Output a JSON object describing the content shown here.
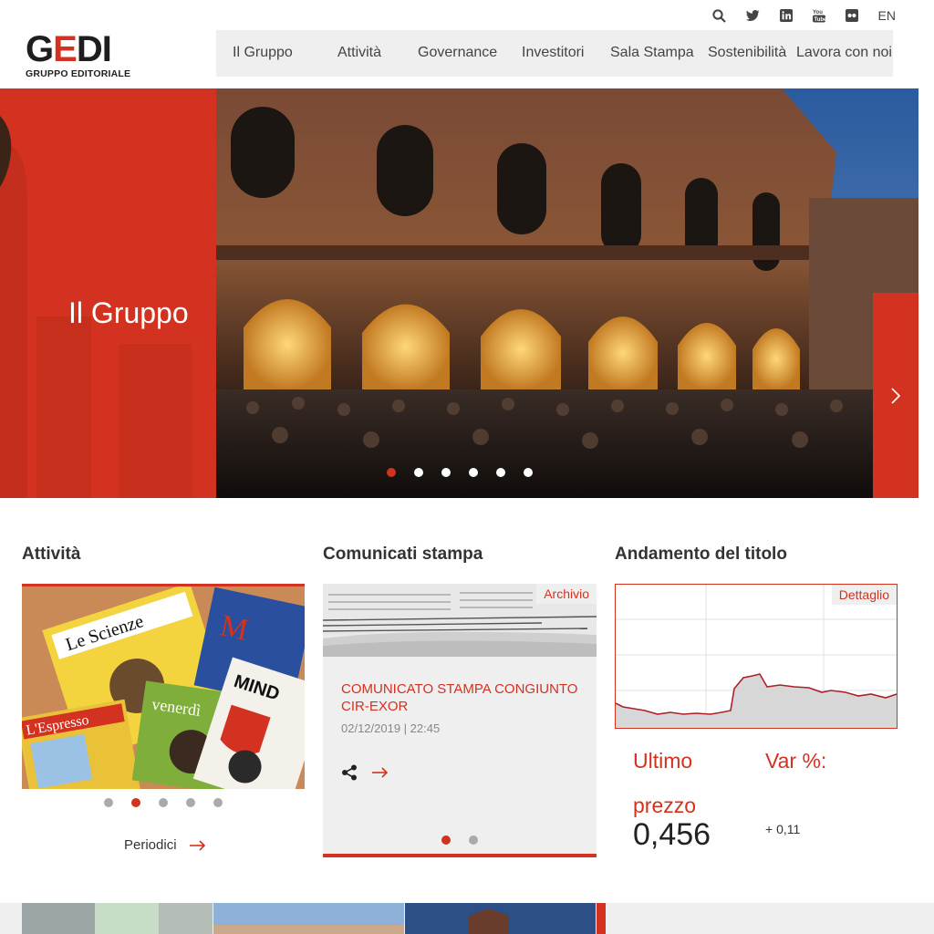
{
  "utility": {
    "icons": [
      "search-icon",
      "twitter-icon",
      "linkedin-icon",
      "youtube-icon",
      "flickr-icon"
    ],
    "lang": "EN"
  },
  "logo": {
    "word_g": "G",
    "word_e": "E",
    "word_di": "DI",
    "sub": "GRUPPO EDITORIALE"
  },
  "nav": {
    "items": [
      "Il Gruppo",
      "Attività",
      "Governance",
      "Investitori",
      "Sala Stampa",
      "Sostenibilità",
      "Lavora con noi"
    ]
  },
  "hero": {
    "title": "Il Gruppo",
    "slides": 6,
    "active_slide": 1
  },
  "attivita": {
    "title": "Attività",
    "link": "Periodici",
    "slides": 5,
    "active_slide": 2
  },
  "comunicati": {
    "title": "Comunicati stampa",
    "tag": "Archivio",
    "headline": "COMUNICATO STAMPA CONGIUNTO CIR-EXOR",
    "date": "02/12/2019 | 22:45",
    "slides": 2,
    "active_slide": 1
  },
  "titolo": {
    "title": "Andamento del titolo",
    "tag": "Dettaglio",
    "last_label_1": "Ultimo",
    "last_label_2": "prezzo",
    "last_value": "0,456",
    "var_label": "Var %:",
    "var_value": "+ 0,11"
  },
  "colors": {
    "accent": "#d2321f",
    "panel": "#efefef",
    "text": "#333333"
  }
}
